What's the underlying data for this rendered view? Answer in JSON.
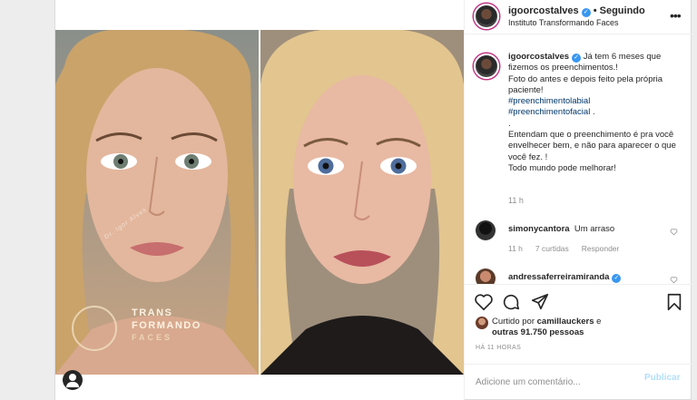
{
  "header": {
    "username": "igoorcostalves",
    "separator": "•",
    "follow_status": "Seguindo",
    "subtitle": "Instituto Transformando Faces",
    "more_icon": "more-horizontal-icon"
  },
  "media": {
    "watermark": {
      "line1": "TRANS",
      "line2": "FORMANDO",
      "line3": "FACES"
    },
    "diagonal_mark": "Dr. Igor Alves"
  },
  "caption": {
    "username": "igoorcostalves",
    "line1": "Já tem 6 meses que fizemos os preenchimentos.!",
    "line2": "Foto do antes e depois feito pela própria paciente!",
    "hashtag1": "#preenchimentolabial",
    "hashtag2": "#preenchimentofacial",
    "hashtag2_suffix": " .",
    "dot": ".",
    "line3": "Entendam que o preenchimento é pra você envelhecer bem, e não para aparecer o que você fez. !",
    "line4": "Todo mundo pode melhorar!",
    "time": "11 h"
  },
  "comments": [
    {
      "username": "simonycantora",
      "text": "Um arraso",
      "time": "11 h",
      "likes": "7 curtidas",
      "reply": "Responder"
    },
    {
      "username": "andressaferreiramiranda",
      "text": ""
    }
  ],
  "actions": {
    "liked_prefix": "Curtido por",
    "liked_user": "camillauckers",
    "liked_join": "e",
    "liked_others": "outras 91.750 pessoas",
    "time_ago": "HÁ 11 HORAS"
  },
  "add_comment": {
    "placeholder": "Adicione um comentário...",
    "post_label": "Publicar"
  },
  "colors": {
    "verified": "#3897f0",
    "hashtag": "#00376b",
    "post_disabled": "#b2dffc",
    "muted": "#8e8e8e"
  }
}
